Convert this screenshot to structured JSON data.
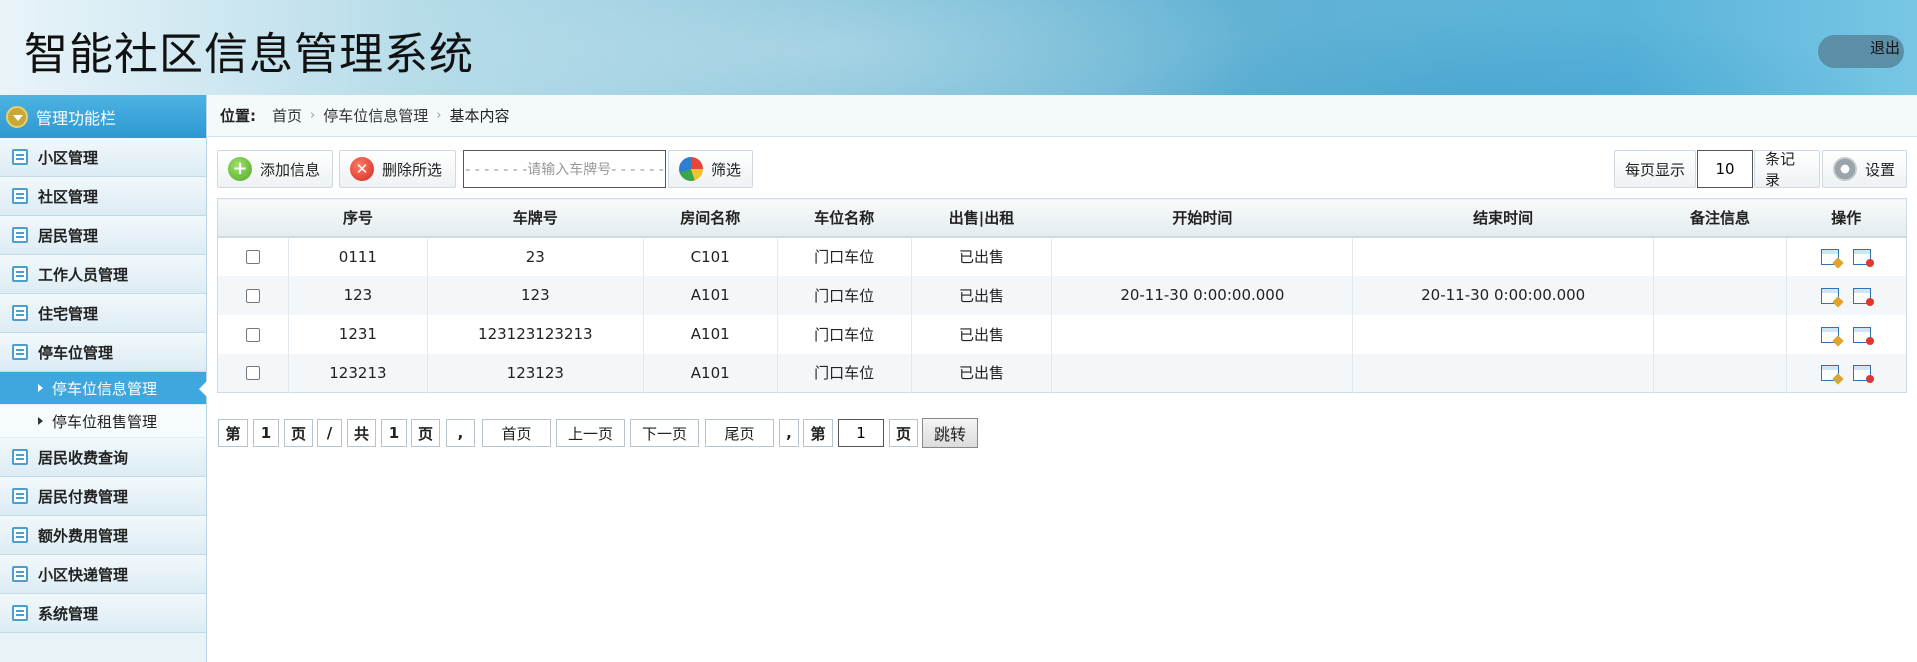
{
  "header": {
    "title": "智能社区信息管理系统",
    "logout_label": "退出"
  },
  "sidebar": {
    "heading": "管理功能栏",
    "items": [
      {
        "label": "小区管理"
      },
      {
        "label": "社区管理"
      },
      {
        "label": "居民管理"
      },
      {
        "label": "工作人员管理"
      },
      {
        "label": "住宅管理"
      },
      {
        "label": "停车位管理"
      },
      {
        "label": "居民收费查询"
      },
      {
        "label": "居民付费管理"
      },
      {
        "label": "额外费用管理"
      },
      {
        "label": "小区快递管理"
      },
      {
        "label": "系统管理"
      }
    ],
    "subitems": [
      {
        "label": "停车位信息管理",
        "active": true
      },
      {
        "label": "停车位租售管理",
        "active": false
      }
    ]
  },
  "breadcrumb": {
    "label": "位置:",
    "items": [
      "首页",
      "停车位信息管理",
      "基本内容"
    ]
  },
  "toolbar": {
    "add_label": "添加信息",
    "delete_label": "删除所选",
    "plate_placeholder": "- - - - - - -请输入车牌号- - - - - -",
    "filter_label": "筛选",
    "per_page_prefix": "每页显示",
    "per_page_value": "10",
    "per_page_suffix": "条记录",
    "settings_label": "设置"
  },
  "table": {
    "headers": [
      "",
      "序号",
      "车牌号",
      "房间名称",
      "车位名称",
      "出售|出租",
      "开始时间",
      "结束时间",
      "备注信息",
      "操作"
    ],
    "rows": [
      {
        "id": "0111",
        "plate": "23",
        "room": "C101",
        "spot": "门口车位",
        "status": "已出售",
        "start": "",
        "end": "",
        "note": ""
      },
      {
        "id": "123",
        "plate": "123",
        "room": "A101",
        "spot": "门口车位",
        "status": "已出售",
        "start": "20-11-30 0:00:00.000",
        "end": "20-11-30 0:00:00.000",
        "note": ""
      },
      {
        "id": "1231",
        "plate": "123123123213",
        "room": "A101",
        "spot": "门口车位",
        "status": "已出售",
        "start": "",
        "end": "",
        "note": ""
      },
      {
        "id": "123213",
        "plate": "123123",
        "room": "A101",
        "spot": "门口车位",
        "status": "已出售",
        "start": "",
        "end": "",
        "note": ""
      }
    ]
  },
  "pager": {
    "di": "第",
    "current": "1",
    "ye": "页",
    "slash": "/",
    "gong": "共",
    "total": "1",
    "ye2": "页",
    "comma": ",",
    "first": "首页",
    "prev": "上一页",
    "next": "下一页",
    "last": "尾页",
    "comma2": ",",
    "di2": "第",
    "jump_value": "1",
    "ye3": "页",
    "jump_label": "跳转"
  },
  "icons": {
    "add": "plus-circle-icon",
    "delete": "x-circle-icon",
    "filter": "pie-chart-icon",
    "settings": "gear-icon",
    "edit": "edit-window-icon",
    "remove": "delete-window-icon"
  },
  "colors": {
    "accent": "#3ea7de",
    "status_sold": "#2a7a1f"
  }
}
